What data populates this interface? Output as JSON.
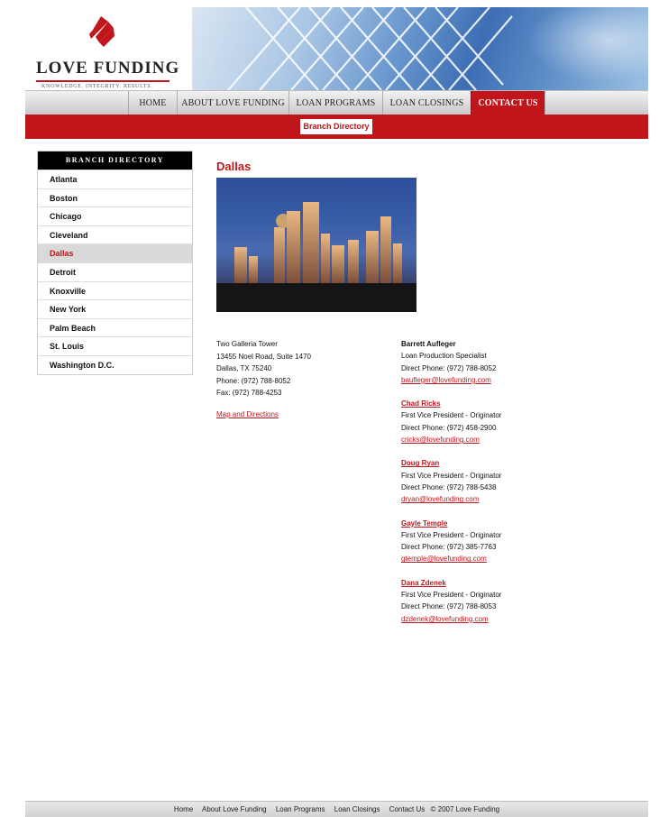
{
  "brand": {
    "name": "LOVE FUNDING",
    "tagline": "KNOWLEDGE. INTEGRITY. RESULTS.",
    "accent_color": "#c0151b"
  },
  "nav": {
    "items": [
      {
        "label": "HOME"
      },
      {
        "label": "ABOUT LOVE FUNDING"
      },
      {
        "label": "LOAN PROGRAMS"
      },
      {
        "label": "LOAN CLOSINGS"
      },
      {
        "label": "CONTACT US"
      }
    ],
    "active": "CONTACT US"
  },
  "subnav": {
    "label": "Branch Directory"
  },
  "sidebar": {
    "title": "BRANCH DIRECTORY",
    "items": [
      {
        "label": "Atlanta"
      },
      {
        "label": "Boston"
      },
      {
        "label": "Chicago"
      },
      {
        "label": "Cleveland"
      },
      {
        "label": "Dallas"
      },
      {
        "label": "Detroit"
      },
      {
        "label": "Knoxville"
      },
      {
        "label": "New York"
      },
      {
        "label": "Palm Beach"
      },
      {
        "label": "St. Louis"
      },
      {
        "label": "Washington D.C."
      }
    ],
    "active": "Dallas"
  },
  "branch": {
    "city": "Dallas",
    "address": {
      "line1": "Two Galleria Tower",
      "line2": "13455 Noel Road, Suite 1470",
      "line3": "Dallas, TX 75240",
      "phone": "Phone: (972) 788-8052",
      "fax": "Fax: (972) 788-4253"
    },
    "map_link": "Map and Directions"
  },
  "contacts": [
    {
      "name": "Barrett Aufleger",
      "title": "Loan Production Specialist",
      "phone": "Direct Phone: (972) 788-8052",
      "email": "baufleger@lovefunding.com"
    },
    {
      "name": "Chad Ricks",
      "title": "First Vice President - Originator",
      "phone": "Direct Phone: (972) 458-2900",
      "email": "cricks@lovefunding.com"
    },
    {
      "name": "Doug Ryan",
      "title": "First Vice President - Originator",
      "phone": "Direct Phone: (972) 788-5438",
      "email": "dryan@lovefunding.com"
    },
    {
      "name": "Gayle Temple",
      "title": "First Vice President - Originator",
      "phone": "Direct Phone: (972) 385-7763",
      "email": "gtemple@lovefunding.com"
    },
    {
      "name": "Dana Zdenek",
      "title": "First Vice President - Originator",
      "phone": "Direct Phone: (972) 788-8053",
      "email": "dzdenek@lovefunding.com"
    }
  ],
  "footer": {
    "links": [
      {
        "label": "Home"
      },
      {
        "label": "About Love Funding"
      },
      {
        "label": "Loan Programs"
      },
      {
        "label": "Loan Closings"
      },
      {
        "label": "Contact Us"
      }
    ],
    "copyright": "© 2007 Love Funding"
  }
}
